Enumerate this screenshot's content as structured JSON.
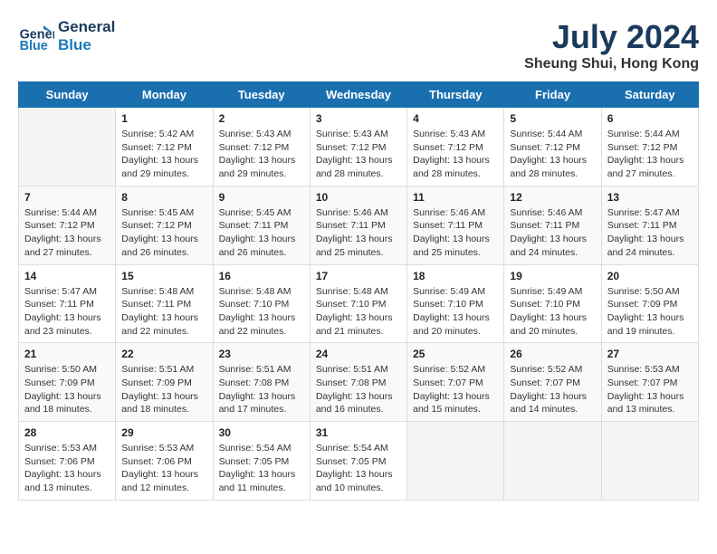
{
  "header": {
    "logo_line1": "General",
    "logo_line2": "Blue",
    "title": "July 2024",
    "subtitle": "Sheung Shui, Hong Kong"
  },
  "days_of_week": [
    "Sunday",
    "Monday",
    "Tuesday",
    "Wednesday",
    "Thursday",
    "Friday",
    "Saturday"
  ],
  "weeks": [
    [
      {
        "day": "",
        "info": ""
      },
      {
        "day": "1",
        "info": "Sunrise: 5:42 AM\nSunset: 7:12 PM\nDaylight: 13 hours\nand 29 minutes."
      },
      {
        "day": "2",
        "info": "Sunrise: 5:43 AM\nSunset: 7:12 PM\nDaylight: 13 hours\nand 29 minutes."
      },
      {
        "day": "3",
        "info": "Sunrise: 5:43 AM\nSunset: 7:12 PM\nDaylight: 13 hours\nand 28 minutes."
      },
      {
        "day": "4",
        "info": "Sunrise: 5:43 AM\nSunset: 7:12 PM\nDaylight: 13 hours\nand 28 minutes."
      },
      {
        "day": "5",
        "info": "Sunrise: 5:44 AM\nSunset: 7:12 PM\nDaylight: 13 hours\nand 28 minutes."
      },
      {
        "day": "6",
        "info": "Sunrise: 5:44 AM\nSunset: 7:12 PM\nDaylight: 13 hours\nand 27 minutes."
      }
    ],
    [
      {
        "day": "7",
        "info": "Sunrise: 5:44 AM\nSunset: 7:12 PM\nDaylight: 13 hours\nand 27 minutes."
      },
      {
        "day": "8",
        "info": "Sunrise: 5:45 AM\nSunset: 7:12 PM\nDaylight: 13 hours\nand 26 minutes."
      },
      {
        "day": "9",
        "info": "Sunrise: 5:45 AM\nSunset: 7:11 PM\nDaylight: 13 hours\nand 26 minutes."
      },
      {
        "day": "10",
        "info": "Sunrise: 5:46 AM\nSunset: 7:11 PM\nDaylight: 13 hours\nand 25 minutes."
      },
      {
        "day": "11",
        "info": "Sunrise: 5:46 AM\nSunset: 7:11 PM\nDaylight: 13 hours\nand 25 minutes."
      },
      {
        "day": "12",
        "info": "Sunrise: 5:46 AM\nSunset: 7:11 PM\nDaylight: 13 hours\nand 24 minutes."
      },
      {
        "day": "13",
        "info": "Sunrise: 5:47 AM\nSunset: 7:11 PM\nDaylight: 13 hours\nand 24 minutes."
      }
    ],
    [
      {
        "day": "14",
        "info": "Sunrise: 5:47 AM\nSunset: 7:11 PM\nDaylight: 13 hours\nand 23 minutes."
      },
      {
        "day": "15",
        "info": "Sunrise: 5:48 AM\nSunset: 7:11 PM\nDaylight: 13 hours\nand 22 minutes."
      },
      {
        "day": "16",
        "info": "Sunrise: 5:48 AM\nSunset: 7:10 PM\nDaylight: 13 hours\nand 22 minutes."
      },
      {
        "day": "17",
        "info": "Sunrise: 5:48 AM\nSunset: 7:10 PM\nDaylight: 13 hours\nand 21 minutes."
      },
      {
        "day": "18",
        "info": "Sunrise: 5:49 AM\nSunset: 7:10 PM\nDaylight: 13 hours\nand 20 minutes."
      },
      {
        "day": "19",
        "info": "Sunrise: 5:49 AM\nSunset: 7:10 PM\nDaylight: 13 hours\nand 20 minutes."
      },
      {
        "day": "20",
        "info": "Sunrise: 5:50 AM\nSunset: 7:09 PM\nDaylight: 13 hours\nand 19 minutes."
      }
    ],
    [
      {
        "day": "21",
        "info": "Sunrise: 5:50 AM\nSunset: 7:09 PM\nDaylight: 13 hours\nand 18 minutes."
      },
      {
        "day": "22",
        "info": "Sunrise: 5:51 AM\nSunset: 7:09 PM\nDaylight: 13 hours\nand 18 minutes."
      },
      {
        "day": "23",
        "info": "Sunrise: 5:51 AM\nSunset: 7:08 PM\nDaylight: 13 hours\nand 17 minutes."
      },
      {
        "day": "24",
        "info": "Sunrise: 5:51 AM\nSunset: 7:08 PM\nDaylight: 13 hours\nand 16 minutes."
      },
      {
        "day": "25",
        "info": "Sunrise: 5:52 AM\nSunset: 7:07 PM\nDaylight: 13 hours\nand 15 minutes."
      },
      {
        "day": "26",
        "info": "Sunrise: 5:52 AM\nSunset: 7:07 PM\nDaylight: 13 hours\nand 14 minutes."
      },
      {
        "day": "27",
        "info": "Sunrise: 5:53 AM\nSunset: 7:07 PM\nDaylight: 13 hours\nand 13 minutes."
      }
    ],
    [
      {
        "day": "28",
        "info": "Sunrise: 5:53 AM\nSunset: 7:06 PM\nDaylight: 13 hours\nand 13 minutes."
      },
      {
        "day": "29",
        "info": "Sunrise: 5:53 AM\nSunset: 7:06 PM\nDaylight: 13 hours\nand 12 minutes."
      },
      {
        "day": "30",
        "info": "Sunrise: 5:54 AM\nSunset: 7:05 PM\nDaylight: 13 hours\nand 11 minutes."
      },
      {
        "day": "31",
        "info": "Sunrise: 5:54 AM\nSunset: 7:05 PM\nDaylight: 13 hours\nand 10 minutes."
      },
      {
        "day": "",
        "info": ""
      },
      {
        "day": "",
        "info": ""
      },
      {
        "day": "",
        "info": ""
      }
    ]
  ]
}
